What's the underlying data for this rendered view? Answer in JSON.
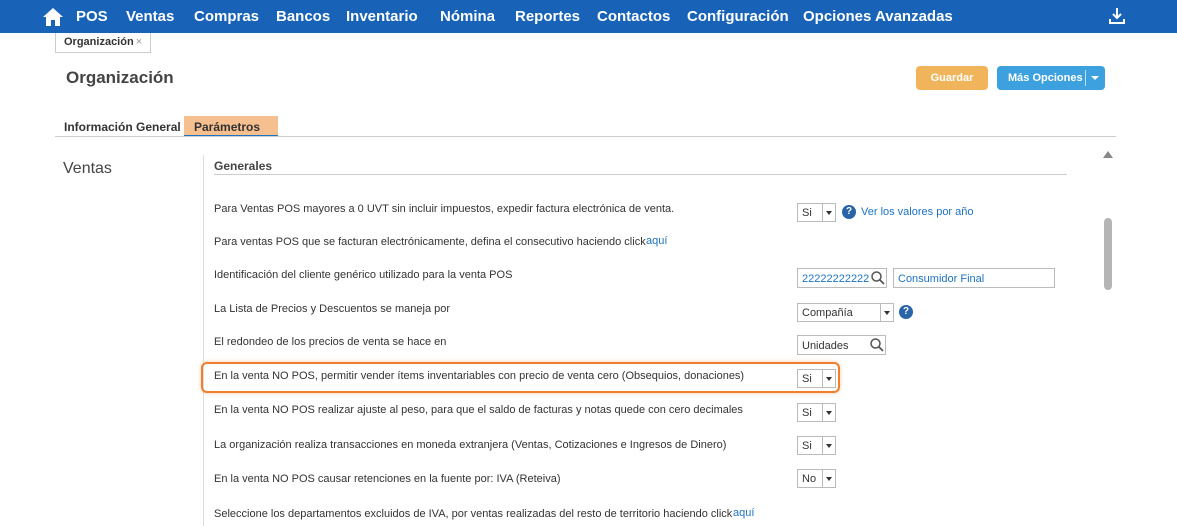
{
  "nav": {
    "items": [
      "POS",
      "Ventas",
      "Compras",
      "Bancos",
      "Inventario",
      "Nómina",
      "Reportes",
      "Contactos",
      "Configuración",
      "Opciones Avanzadas"
    ],
    "bg": "#1863b8"
  },
  "page_tab": {
    "label": "Organización",
    "close": "×"
  },
  "page_title": "Organización",
  "buttons": {
    "save": "Guardar",
    "more": "Más Opciones"
  },
  "section_tabs": [
    "Información General",
    "Parámetros"
  ],
  "side_label": "Ventas",
  "group_title": "Generales",
  "rows": [
    {
      "label": "Para Ventas POS mayores a 0 UVT sin incluir impuestos, expedir factura electrónica de venta.",
      "value": "Si",
      "link": "Ver los valores por año"
    },
    {
      "label": "Para ventas POS que se facturan electrónicamente, defina el consecutivo haciendo click",
      "link": "aquí"
    },
    {
      "label": "Identificación del cliente genérico utilizado para la venta POS",
      "value": "22222222222",
      "name": "Consumidor Final"
    },
    {
      "label": "La Lista de Precios y Descuentos se maneja por",
      "value": "Compañía"
    },
    {
      "label": "El redondeo de los precios de venta se hace en",
      "value": "Unidades"
    },
    {
      "label": "En la venta NO POS, permitir vender ítems inventariables con precio de venta cero (Obsequios, donaciones)",
      "value": "Si"
    },
    {
      "label": "En la venta NO POS realizar ajuste al peso, para que el saldo de facturas y notas quede con cero decimales",
      "value": "Si"
    },
    {
      "label": "La organización realiza transacciones en moneda extranjera (Ventas, Cotizaciones e Ingresos de Dinero)",
      "value": "Si"
    },
    {
      "label": "En la venta NO POS causar retenciones en la fuente por: IVA (Reteiva)",
      "value": "No"
    },
    {
      "label": "Seleccione los departamentos excluidos de IVA, por ventas realizadas del resto de territorio haciendo click",
      "link": "aquí"
    }
  ],
  "colors": {
    "accent": "#ef7f2e",
    "save": "#f0b55b",
    "more": "#3da1e0",
    "link": "#1e72c0"
  }
}
